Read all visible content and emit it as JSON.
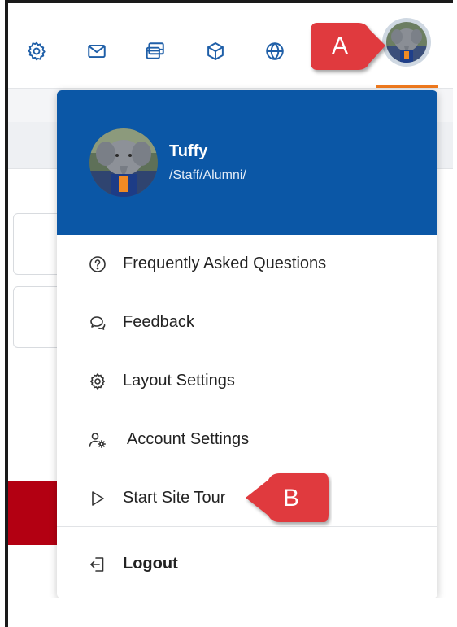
{
  "toolbar": {
    "icons": [
      {
        "name": "settings-icon"
      },
      {
        "name": "mail-icon"
      },
      {
        "name": "messages-icon"
      },
      {
        "name": "box-icon"
      },
      {
        "name": "globe-icon"
      }
    ],
    "avatar": "user-avatar"
  },
  "profile": {
    "name": "Tuffy",
    "path": "/Staff/Alumni/"
  },
  "menu": {
    "items": [
      {
        "label": "Frequently Asked Questions",
        "icon": "question-circle-icon"
      },
      {
        "label": "Feedback",
        "icon": "chat-bubbles-icon"
      },
      {
        "label": "Layout Settings",
        "icon": "gear-icon"
      },
      {
        "label": "Account Settings",
        "icon": "user-gear-icon"
      },
      {
        "label": "Start Site Tour",
        "icon": "play-outline-icon"
      }
    ],
    "logout": {
      "label": "Logout",
      "icon": "logout-icon"
    }
  },
  "callouts": {
    "a": "A",
    "b": "B"
  },
  "colors": {
    "accent_blue": "#0b57a6",
    "icon_blue": "#1f5fa8",
    "callout_red": "#e03a3e",
    "active_underline": "#f07a1e"
  }
}
